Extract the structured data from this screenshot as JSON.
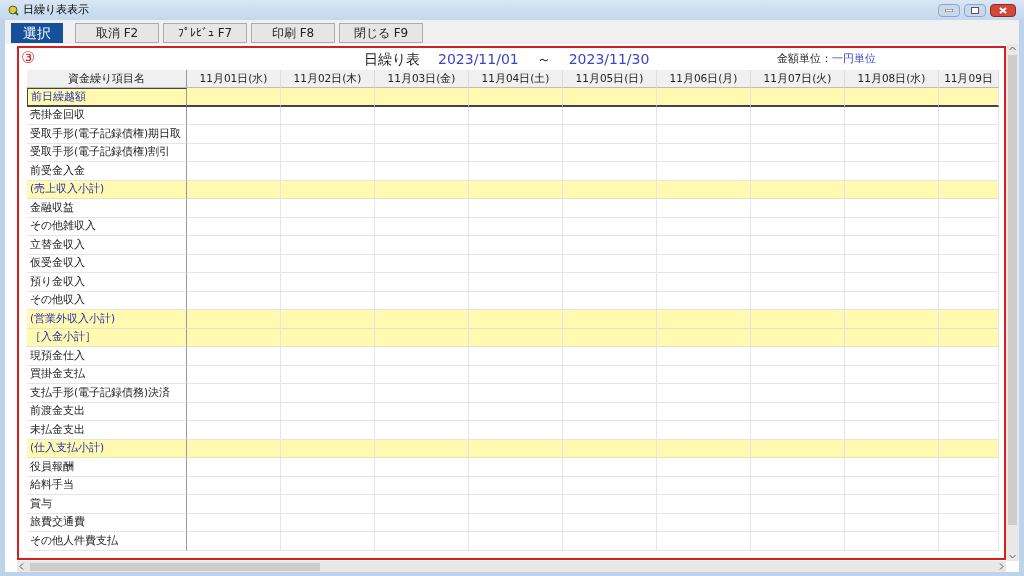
{
  "window": {
    "title": "日繰り表表示"
  },
  "toolbar": {
    "mode": "選択",
    "buttons": [
      "取消 F2",
      "ﾌﾟﾚﾋﾞｭ F7",
      "印刷 F8",
      "閉じる F9"
    ]
  },
  "marker": "③",
  "report": {
    "title": "日繰り表",
    "date_from": "2023/11/01",
    "separator": "～",
    "date_to": "2023/11/30",
    "unit_label": "金額単位：",
    "unit_value": "一円単位"
  },
  "table": {
    "columns": [
      "資金繰り項目名",
      "11月01日(水)",
      "11月02日(木)",
      "11月03日(金)",
      "11月04日(土)",
      "11月05日(日)",
      "11月06日(月)",
      "11月07日(火)",
      "11月08日(水)",
      "11月09日"
    ],
    "rows": [
      {
        "label": "前日繰越額",
        "kind": "carryover"
      },
      {
        "label": "売掛金回収",
        "kind": "item"
      },
      {
        "label": "受取手形(電子記録債権)期日取",
        "kind": "item"
      },
      {
        "label": "受取手形(電子記録債権)割引",
        "kind": "item"
      },
      {
        "label": "前受金入金",
        "kind": "item"
      },
      {
        "label": "(売上収入小計)",
        "kind": "subtotal"
      },
      {
        "label": "金融収益",
        "kind": "item"
      },
      {
        "label": "その他雑収入",
        "kind": "item"
      },
      {
        "label": "立替金収入",
        "kind": "item"
      },
      {
        "label": "仮受金収入",
        "kind": "item"
      },
      {
        "label": "預り金収入",
        "kind": "item"
      },
      {
        "label": "その他収入",
        "kind": "item"
      },
      {
        "label": "(営業外収入小計)",
        "kind": "subtotal"
      },
      {
        "label": "［入金小計］",
        "kind": "subtotal"
      },
      {
        "label": "現預金仕入",
        "kind": "item"
      },
      {
        "label": "買掛金支払",
        "kind": "item"
      },
      {
        "label": "支払手形(電子記録債務)決済",
        "kind": "item"
      },
      {
        "label": "前渡金支出",
        "kind": "item"
      },
      {
        "label": "未払金支出",
        "kind": "item"
      },
      {
        "label": "(仕入支払小計)",
        "kind": "subtotal"
      },
      {
        "label": "役員報酬",
        "kind": "item"
      },
      {
        "label": "給料手当",
        "kind": "item"
      },
      {
        "label": "賞与",
        "kind": "item"
      },
      {
        "label": "旅費交通費",
        "kind": "item"
      },
      {
        "label": "その他人件費支払",
        "kind": "item"
      }
    ]
  }
}
